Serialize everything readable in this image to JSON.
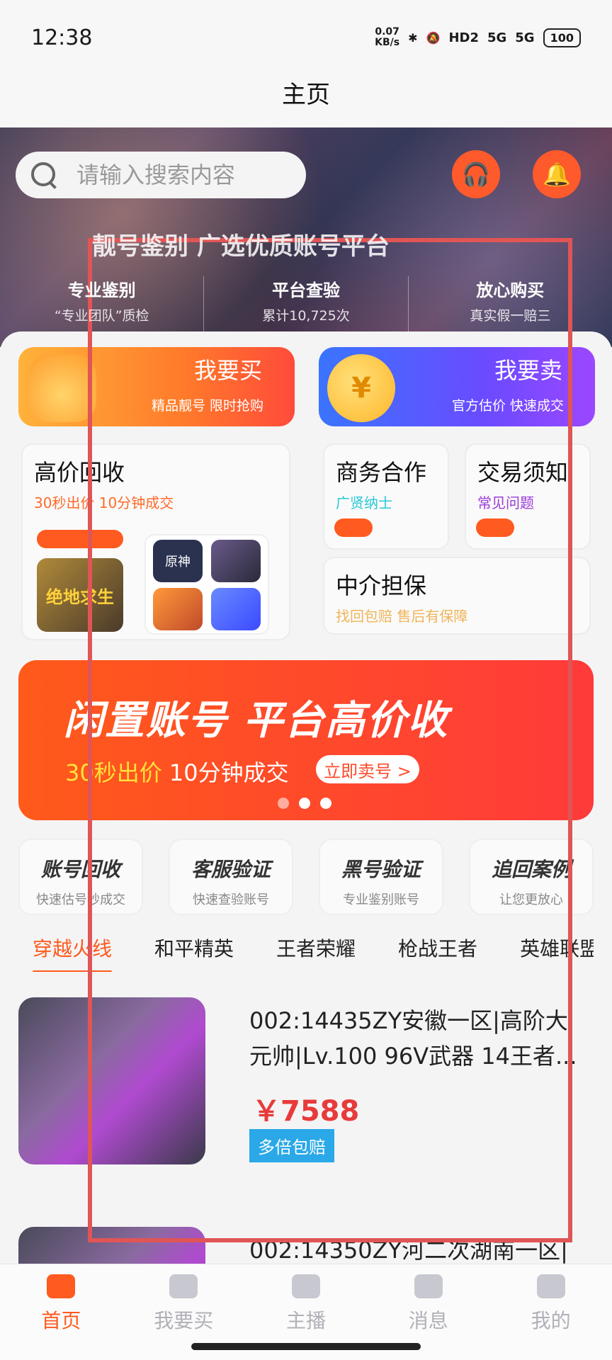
{
  "status_bar": {
    "time": "12:38",
    "net_speed_value": "0.07",
    "net_speed_unit": "KB/s",
    "hd": "HD2",
    "sig1": "5G",
    "sig2": "5G",
    "battery": "100"
  },
  "header": {
    "title": "主页"
  },
  "search": {
    "placeholder": "请输入搜索内容"
  },
  "hero": {
    "slogan": "靓号鉴别 广选优质账号平台",
    "features": [
      {
        "title": "专业鉴别",
        "sub": "“专业团队”质检"
      },
      {
        "title": "平台查验",
        "sub": "累计10,725次"
      },
      {
        "title": "放心购买",
        "sub": "真实假一赔三"
      }
    ]
  },
  "buy": {
    "title": "我要买",
    "sub": "精品靓号 限时抢购"
  },
  "sell": {
    "title": "我要卖",
    "sub": "官方估价 快速成交",
    "coin": "¥"
  },
  "recycle": {
    "title": "高价回收",
    "sub": "30秒出价 10分钟成交",
    "pubg_label": "绝地求生",
    "genshin_label": "原神"
  },
  "business": {
    "title": "商务合作",
    "sub": "广贤纳士"
  },
  "rules": {
    "title": "交易须知",
    "sub": "常见问题"
  },
  "agent": {
    "title": "中介担保",
    "sub": "找回包赔 售后有保障"
  },
  "banner": {
    "title": "闲置账号 平台高价收",
    "sub_hl": "30秒出价",
    "sub_rest": " 10分钟成交",
    "button": "立即卖号 >"
  },
  "quick": [
    {
      "title": "账号回收",
      "sub": "快速估号秒成交"
    },
    {
      "title": "客服验证",
      "sub": "快速查验账号"
    },
    {
      "title": "黑号验证",
      "sub": "专业鉴别账号"
    },
    {
      "title": "追回案例",
      "sub": "让您更放心"
    }
  ],
  "tabs": [
    "穿越火线",
    "和平精英",
    "王者荣耀",
    "枪战王者",
    "英雄联盟"
  ],
  "products": [
    {
      "title": "002:14435ZY安徽一区|高阶大元帅|Lv.100 96V武器 14王者...",
      "price": "￥7588",
      "tag": "多倍包赔"
    },
    {
      "title": "002:14350ZY河二次湖南一区|"
    }
  ],
  "bottom_nav": [
    "首页",
    "我要买",
    "主播",
    "消息",
    "我的"
  ]
}
